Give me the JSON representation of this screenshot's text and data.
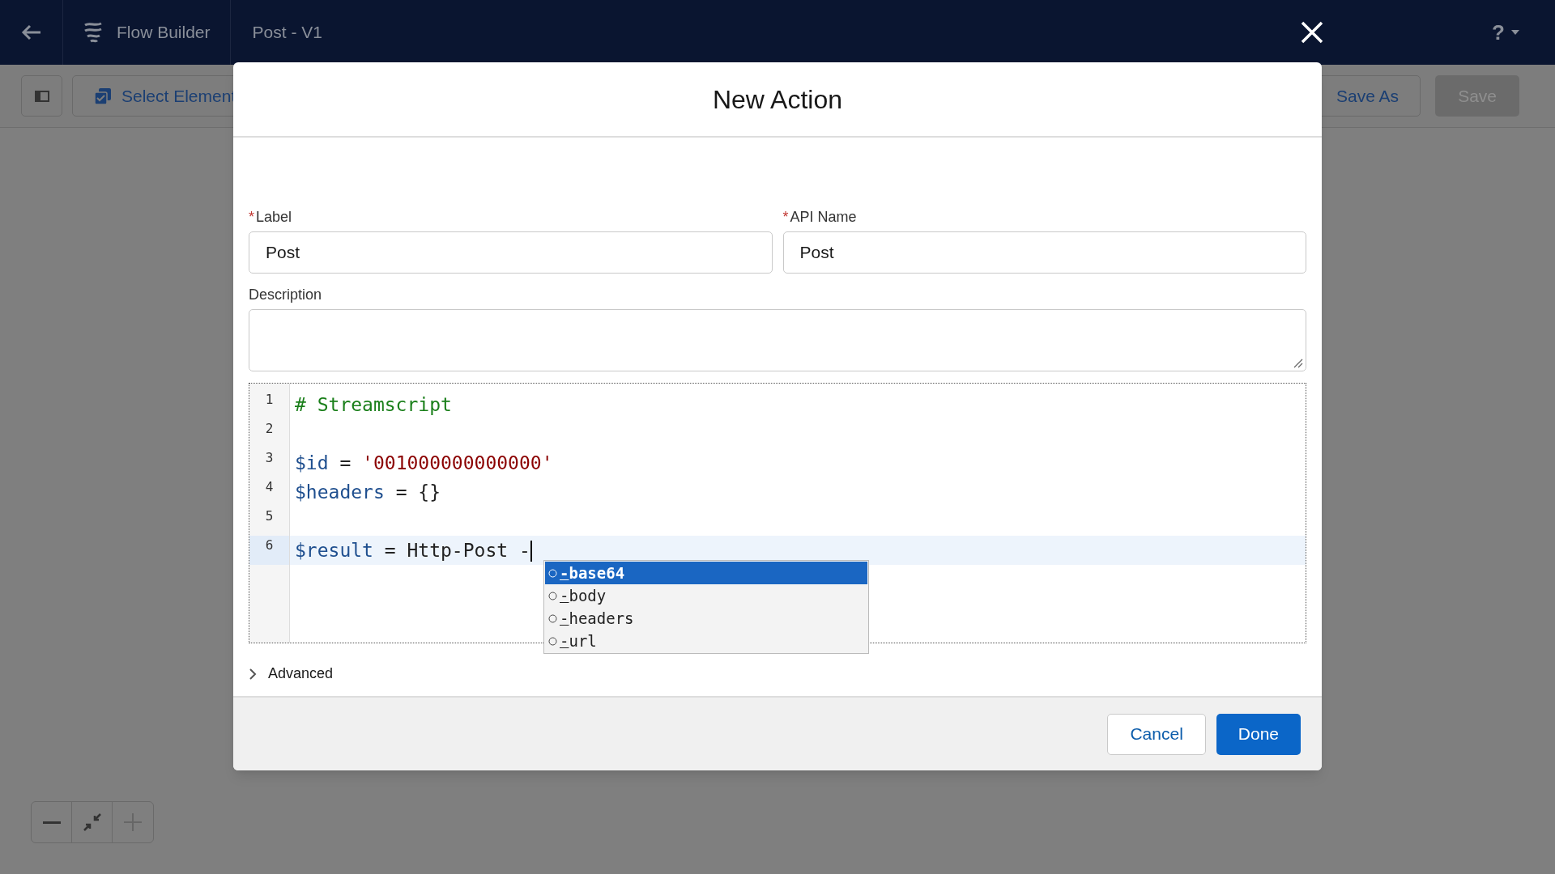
{
  "top_bar": {
    "app_name": "Flow Builder",
    "flow_name": "Post - V1",
    "help": "?"
  },
  "toolbar": {
    "select_elements": "Select Element",
    "buttons": [
      {
        "label": "Save As",
        "disabled": false
      },
      {
        "label": "Save",
        "disabled": true
      }
    ]
  },
  "modal": {
    "title": "New Action",
    "fields": [
      {
        "label": "Label",
        "required_mark": "*",
        "value": "Post"
      },
      {
        "label": "API Name",
        "required_mark": "*",
        "value": "Post"
      }
    ],
    "description": {
      "label": "Description"
    },
    "code_lines": [
      {
        "number": "1",
        "active": false,
        "tokens": [
          {
            "kind": "comment",
            "text": "# Streamscript"
          }
        ]
      },
      {
        "number": "2",
        "active": false
      },
      {
        "number": "3",
        "active": false,
        "tokens": [
          {
            "kind": "variable",
            "text": "$id"
          },
          {
            "kind": "plain",
            "text": " = "
          },
          {
            "kind": "string",
            "text": "'001000000000000'"
          }
        ]
      },
      {
        "number": "4",
        "active": false,
        "tokens": [
          {
            "kind": "variable",
            "text": "$headers"
          },
          {
            "kind": "plain",
            "text": " = {}"
          }
        ]
      },
      {
        "number": "5",
        "active": false
      },
      {
        "number": "6",
        "active": true,
        "tokens": [
          {
            "kind": "variable",
            "text": "$result"
          },
          {
            "kind": "plain",
            "text": " = Http-Post -"
          }
        ]
      }
    ],
    "autocomplete": [
      {
        "match": "-",
        "rest": "base64",
        "selected": true
      },
      {
        "match": "-",
        "rest": "body",
        "selected": false
      },
      {
        "match": "-",
        "rest": "headers",
        "selected": false
      },
      {
        "match": "-",
        "rest": "url",
        "selected": false
      }
    ],
    "advanced": {
      "label": "Advanced",
      "expanded": false
    },
    "footer_buttons": [
      {
        "label": "Cancel",
        "kind": "neutral"
      },
      {
        "label": "Done",
        "kind": "brand"
      }
    ]
  }
}
